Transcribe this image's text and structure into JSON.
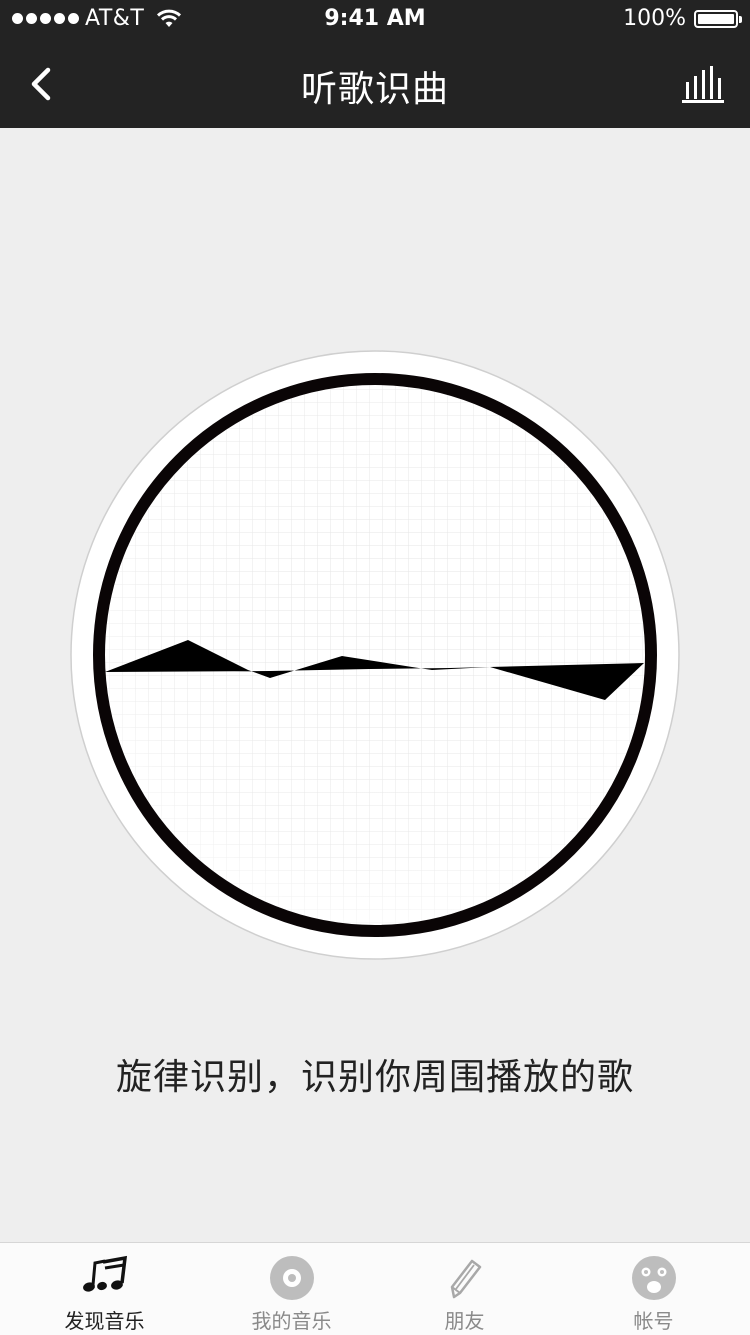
{
  "status_bar": {
    "carrier": "AT&T",
    "time": "9:41 AM",
    "battery": "100%",
    "signal_icon": "signal-dots-icon",
    "wifi_icon": "wifi-icon",
    "battery_icon": "battery-icon"
  },
  "nav": {
    "title": "听歌识曲",
    "back_icon": "chevron-left-icon",
    "chart_icon": "bar-chart-icon"
  },
  "main": {
    "caption": "旋律识别，识别你周围播放的歌",
    "visual_icon": "waveform-disc-icon"
  },
  "tabbar": {
    "tabs": [
      {
        "label": "发现音乐",
        "icon": "music-note-icon",
        "active": true
      },
      {
        "label": "我的音乐",
        "icon": "disc-icon",
        "active": false
      },
      {
        "label": "朋友",
        "icon": "pencil-icon",
        "active": false
      },
      {
        "label": "帐号",
        "icon": "face-icon",
        "active": false
      }
    ]
  },
  "colors": {
    "header_bg": "#232323",
    "page_bg": "#eeeeee",
    "tab_active": "#222222",
    "tab_inactive": "#8a8a8a"
  }
}
